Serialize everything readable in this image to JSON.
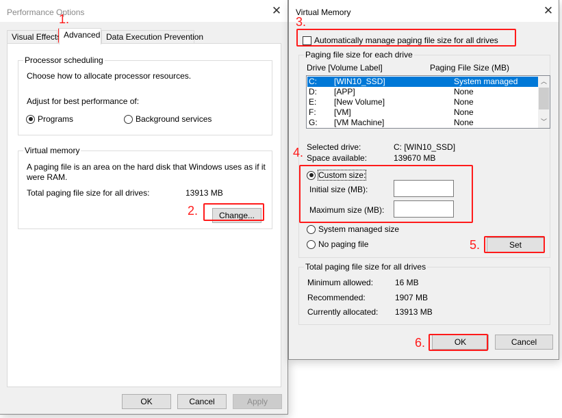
{
  "perf_dialog": {
    "title": "Performance Options",
    "tabs": [
      {
        "label": "Visual Effects",
        "active": false
      },
      {
        "label": "Advanced",
        "active": true
      },
      {
        "label": "Data Execution Prevention",
        "active": false
      }
    ],
    "processor_scheduling": {
      "legend": "Processor scheduling",
      "description": "Choose how to allocate processor resources.",
      "adjust_label": "Adjust for best performance of:",
      "options": [
        {
          "label": "Programs",
          "selected": true
        },
        {
          "label": "Background services",
          "selected": false
        }
      ]
    },
    "virtual_memory": {
      "legend": "Virtual memory",
      "description_line1": "A paging file is an area on the hard disk that Windows uses as if it",
      "description_line2": "were RAM.",
      "total_label": "Total paging file size for all drives:",
      "total_value": "13913 MB",
      "change_button": "Change..."
    },
    "buttons": {
      "ok": "OK",
      "cancel": "Cancel",
      "apply": "Apply"
    }
  },
  "vm_dialog": {
    "title": "Virtual Memory",
    "auto_manage": {
      "label": "Automatically manage paging file size for all drives",
      "checked": false
    },
    "paging_group": {
      "legend": "Paging file size for each drive",
      "col_drive": "Drive  [Volume Label]",
      "col_size": "Paging File Size (MB)",
      "drives": [
        {
          "drive": "C:",
          "label": "[WIN10_SSD]",
          "size": "System managed",
          "selected": true
        },
        {
          "drive": "D:",
          "label": "[APP]",
          "size": "None",
          "selected": false
        },
        {
          "drive": "E:",
          "label": "[New Volume]",
          "size": "None",
          "selected": false
        },
        {
          "drive": "F:",
          "label": "[VM]",
          "size": "None",
          "selected": false
        },
        {
          "drive": "G:",
          "label": "[VM Machine]",
          "size": "None",
          "selected": false
        }
      ],
      "selected_drive_label": "Selected drive:",
      "selected_drive_value": "C:  [WIN10_SSD]",
      "space_label": "Space available:",
      "space_value": "139670 MB",
      "custom_size": {
        "label": "Custom size:",
        "selected": true
      },
      "initial_size": {
        "label": "Initial size (MB):",
        "value": ""
      },
      "maximum_size": {
        "label": "Maximum size (MB):",
        "value": ""
      },
      "system_managed": {
        "label": "System managed size",
        "selected": false
      },
      "no_paging": {
        "label": "No paging file",
        "selected": false
      },
      "set_button": "Set"
    },
    "total_group": {
      "legend": "Total paging file size for all drives",
      "rows": [
        {
          "label": "Minimum allowed:",
          "value": "16 MB"
        },
        {
          "label": "Recommended:",
          "value": "1907 MB"
        },
        {
          "label": "Currently allocated:",
          "value": "13913 MB"
        }
      ]
    },
    "buttons": {
      "ok": "OK",
      "cancel": "Cancel"
    }
  },
  "annotations": {
    "color": "#ff1a1a",
    "steps": [
      "1.",
      "2.",
      "3.",
      "4.",
      "5.",
      "6."
    ]
  }
}
